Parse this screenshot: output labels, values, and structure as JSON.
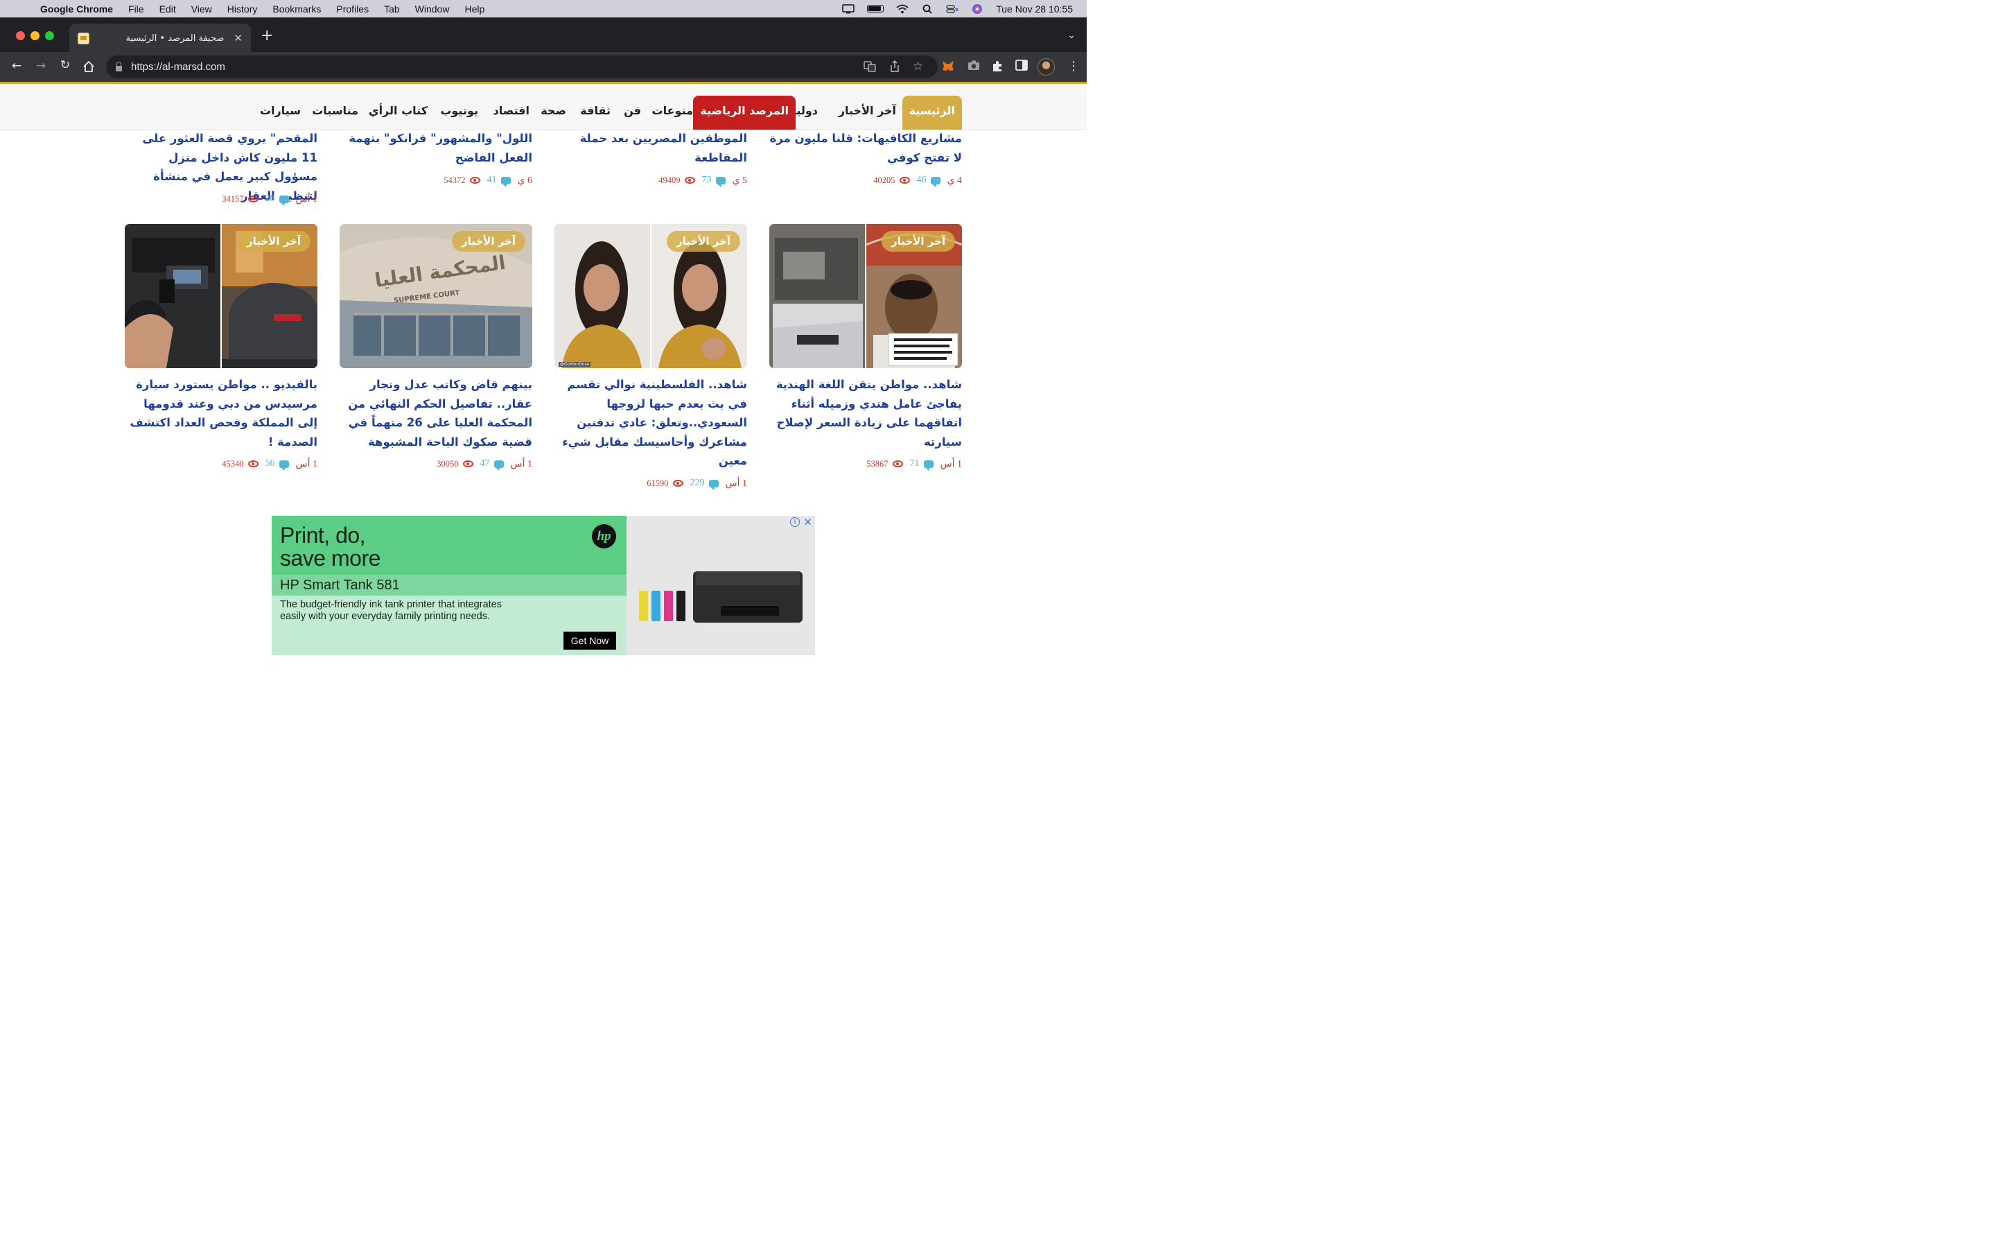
{
  "menubar": {
    "app_name": "Google Chrome",
    "items": [
      "File",
      "Edit",
      "View",
      "History",
      "Bookmarks",
      "Profiles",
      "Tab",
      "Window",
      "Help"
    ],
    "datetime": "Tue Nov 28  10:55"
  },
  "browser": {
    "tab_title": "صحيفة المرصد • الرئيسية",
    "url": "https://al-marsd.com"
  },
  "nav": {
    "items": [
      "الرئيسية",
      "آخر الأخبار",
      "دولية",
      "المرصد الرياضية",
      "منوعات",
      "فن",
      "ثقافة",
      "صحة",
      "اقتصاد",
      "يوتيوب",
      "كتاب الرأي",
      "مناسبات",
      "سيارات"
    ]
  },
  "top_articles": [
    {
      "title": "مشاريع الكافيهات: قلنا مليون مرة لا تفتح كوفي",
      "date": "4 ي",
      "comments": "46",
      "views": "40205"
    },
    {
      "title": "الموظفين المصريين بعد حملة المقاطعة",
      "date": "5 ي",
      "comments": "73",
      "views": "49409"
    },
    {
      "title": "اللول\" والمشهور\" فرانكو\" بتهمة الفعل الفاضح",
      "date": "6 ي",
      "comments": "41",
      "views": "54372"
    },
    {
      "title": "المقحم\" يروي قصة العثور على 11 مليون كاش داخل منزل مسؤول كبير يعمل في منشأة لتنظيم العقار",
      "date": "1 أس",
      "comments": "28",
      "views": "34157"
    }
  ],
  "articles": [
    {
      "badge": "آخر الأخبار",
      "title": "شاهد.. مواطن يتقن اللغة الهندية يفاجئ عامل هندي وزميله أثناء اتفاقهما على زيادة السعر لإصلاح سيارته",
      "date": "1 أس",
      "comments": "71",
      "views": "53867"
    },
    {
      "badge": "آخر الأخبار",
      "title": "شاهد.. الفلسطينية نوالي تقسم في بث بعدم حبها لزوجها السعودي..وتعلق: عادي تدفنين مشاعرك وأحاسيسك مقابل شيء معين",
      "date": "1 أس",
      "comments": "229",
      "views": "61590"
    },
    {
      "badge": "آخر الأخبار",
      "title": "بينهم قاض وكاتب عدل وتجار عقار.. تفاصيل الحكم النهائي من المحكمة العليا على 26 متهماً في قضية صكوك الباحة المشبوهة",
      "date": "1 أس",
      "comments": "47",
      "views": "30050"
    },
    {
      "badge": "آخر الأخبار",
      "title": "بالفيديو .. مواطن يستورد سيارة مرسيدس من دبي وعند قدومها إلى المملكة وفحص العداد اكتشف الصدمة !",
      "date": "1 أس",
      "comments": "56",
      "views": "45340"
    }
  ],
  "thumbnail_text": {
    "court_sign": "المحكمة العليا",
    "court_en": "SUPREME COURT",
    "watermark": "@GoldenDose"
  },
  "ad": {
    "headline_1": "Print, do,",
    "headline_2": "save more",
    "model": "HP Smart Tank 581",
    "description": "The budget-friendly ink tank printer that integrates easily with your everyday family printing needs.",
    "cta": "Get Now",
    "logo": "hp",
    "info": "i",
    "close": "✕"
  },
  "colors": {
    "accent_gold": "#d4ad47",
    "sport_red": "#c51e1e",
    "title_blue": "#1e3f9c",
    "meta_red": "#d43a2b",
    "meta_cyan": "#4fb6d6"
  }
}
